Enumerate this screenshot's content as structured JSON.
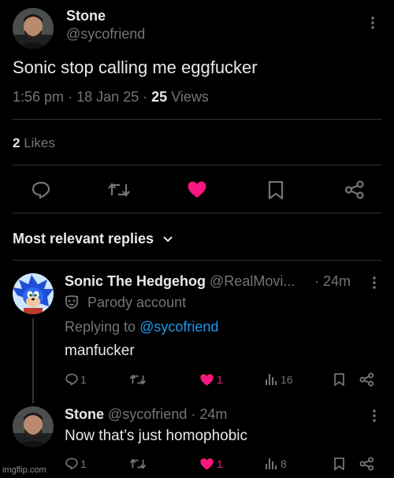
{
  "tweet": {
    "author_name": "Stone",
    "author_handle": "@sycofriend",
    "text": "Sonic stop calling me eggfucker",
    "time": "1:56 pm",
    "date": "18 Jan 25",
    "views_count": "25",
    "views_label": "Views",
    "likes_count": "2",
    "likes_label": "Likes"
  },
  "replies_header": "Most relevant replies",
  "replies": [
    {
      "name": "Sonic The Hedgehog",
      "handle": "@RealMovi...",
      "time": "· 24m",
      "badge": "Parody account",
      "replying_prefix": "Replying to",
      "replying_handle": "@sycofriend",
      "text": "manfucker",
      "reply_count": "1",
      "like_count": "1",
      "view_count": "16"
    },
    {
      "name": "Stone",
      "handle": "@sycofriend",
      "time": "· 24m",
      "text": "Now that’s just homophobic",
      "reply_count": "1",
      "like_count": "1",
      "view_count": "8"
    }
  ],
  "watermark": "imgflip.com",
  "colors": {
    "background": "#000000",
    "text": "#e7e9ea",
    "muted": "#71767b",
    "like": "#f91880",
    "link": "#1d9bf0",
    "divider": "#2f3336"
  },
  "icons": [
    "more-icon",
    "reply-icon",
    "retweet-icon",
    "heart-icon",
    "bookmark-icon",
    "share-icon",
    "chevron-down-icon",
    "views-icon",
    "parody-mask-icon"
  ]
}
